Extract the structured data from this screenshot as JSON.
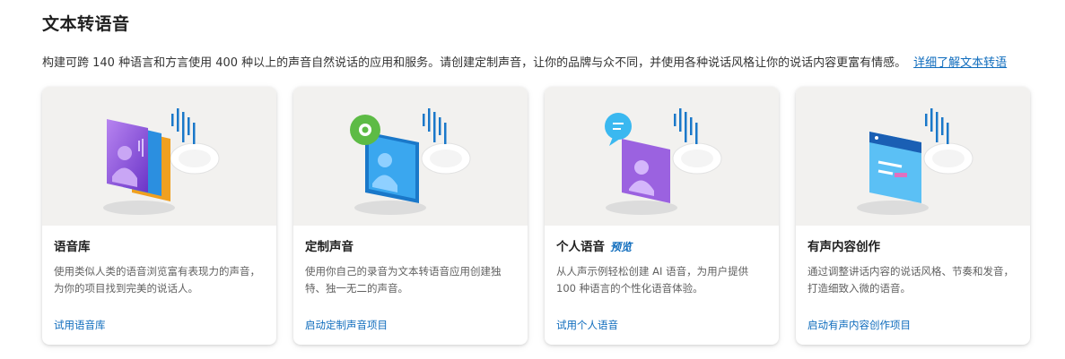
{
  "page": {
    "title": "文本转语音",
    "description": "构建可跨 140 种语言和方言使用 400 种以上的声音自然说话的应用和服务。请创建定制声音，让你的品牌与众不同，并使用各种说话风格让你的说话内容更富有情感。",
    "learn_more_link": "详细了解文本转语"
  },
  "cards": [
    {
      "title": "语音库",
      "badge": "",
      "description": "使用类似人类的语音浏览富有表现力的声音，为你的项目找到完美的说话人。",
      "link": "试用语音库",
      "illustration": "voice-gallery-illustration"
    },
    {
      "title": "定制声音",
      "badge": "",
      "description": "使用你自己的录音为文本转语音应用创建独特、独一无二的声音。",
      "link": "启动定制声音项目",
      "illustration": "custom-voice-illustration"
    },
    {
      "title": "个人语音",
      "badge": "预览",
      "description": "从人声示例轻松创建 AI 语音，为用户提供 100 种语言的个性化语音体验。",
      "link": "试用个人语音",
      "illustration": "personal-voice-illustration"
    },
    {
      "title": "有声内容创作",
      "badge": "",
      "description": "通过调整讲话内容的说话风格、节奏和发音，打造细致入微的语音。",
      "link": "启动有声内容创作项目",
      "illustration": "audio-content-creation-illustration"
    }
  ],
  "colors": {
    "accent": "#0f6cbd",
    "card_image_bg": "#f2f1ef",
    "purple": "#8a4fd8",
    "blue": "#2b8fe0",
    "green": "#5dbb45",
    "orange": "#f0a020"
  }
}
